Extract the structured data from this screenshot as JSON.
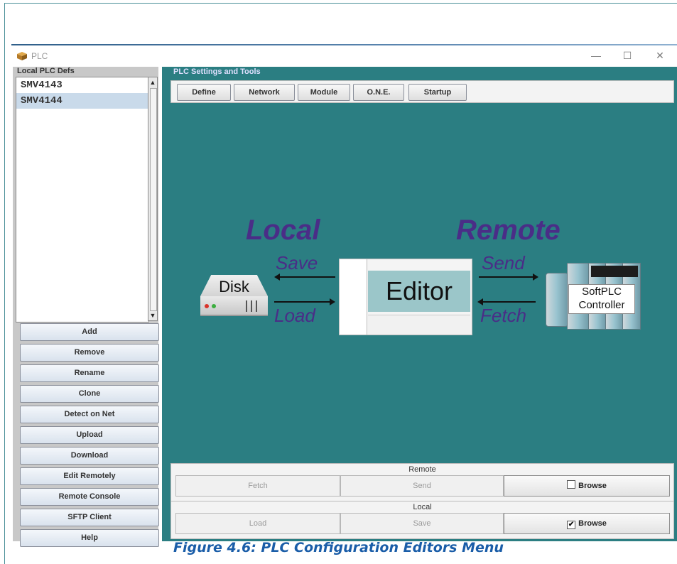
{
  "window": {
    "title": "PLC",
    "controls": {
      "minimize": "—",
      "maximize": "☐",
      "close": "✕"
    }
  },
  "left_panel": {
    "heading": "Local PLC Defs",
    "items": [
      {
        "label": "SMV4143",
        "selected": false
      },
      {
        "label": "SMV4144",
        "selected": true
      }
    ],
    "buttons": [
      "Add",
      "Remove",
      "Rename",
      "Clone",
      "Detect on Net",
      "Upload",
      "Download",
      "Edit Remotely",
      "Remote Console",
      "SFTP Client",
      "Help"
    ]
  },
  "right_panel": {
    "heading": "PLC Settings and Tools",
    "tabs": [
      "Define",
      "Network",
      "Module",
      "O.N.E.",
      "Startup"
    ],
    "diagram": {
      "local": "Local",
      "remote": "Remote",
      "save": "Save",
      "load": "Load",
      "send": "Send",
      "fetch": "Fetch",
      "disk": "Disk",
      "editor": "Editor",
      "controller_line1": "SoftPLC",
      "controller_line2": "Controller"
    },
    "remote_box": {
      "title": "Remote",
      "fetch": "Fetch",
      "send": "Send",
      "browse": "Browse",
      "browse_checked": false
    },
    "local_box": {
      "title": "Local",
      "load": "Load",
      "save": "Save",
      "browse": "Browse",
      "browse_checked": true
    }
  },
  "caption": "Figure 4.6: PLC Configuration Editors Menu",
  "colors": {
    "teal_background": "#2b7e82",
    "diagram_text": "#4a2d87",
    "caption": "#1a5da8",
    "selection": "#c9daea"
  },
  "icons": [
    "plc-app-icon",
    "disk-icon",
    "editor-thumbnail",
    "controller-image"
  ]
}
